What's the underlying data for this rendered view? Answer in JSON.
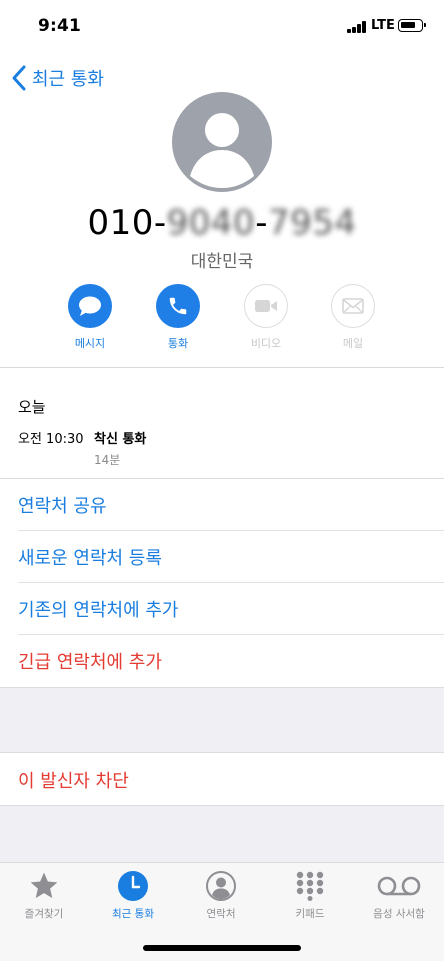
{
  "status_bar": {
    "time": "9:41",
    "network": "LTE"
  },
  "nav": {
    "back_label": "최근 통화"
  },
  "contact": {
    "number_prefix": "010-",
    "number_hidden_1": "9040",
    "number_sep": "-",
    "number_hidden_2": "7954",
    "country": "대한민국"
  },
  "actions": [
    {
      "label": "메시지",
      "icon": "message-icon",
      "enabled": true
    },
    {
      "label": "통화",
      "icon": "phone-icon",
      "enabled": true
    },
    {
      "label": "비디오",
      "icon": "video-icon",
      "enabled": false
    },
    {
      "label": "메일",
      "icon": "mail-icon",
      "enabled": false
    }
  ],
  "call_log": {
    "day": "오늘",
    "time": "오전 10:30",
    "type": "착신 통화",
    "duration": "14분"
  },
  "menu": [
    {
      "label": "연락처 공유"
    },
    {
      "label": "새로운 연락처 등록"
    },
    {
      "label": "기존의 연락처에 추가"
    },
    {
      "label": "긴급 연락처에 추가"
    }
  ],
  "block": {
    "label": "이 발신자 차단"
  },
  "tabs": [
    {
      "label": "즐겨찾기",
      "icon": "star-icon",
      "active": false
    },
    {
      "label": "최근 통화",
      "icon": "clock-icon",
      "active": true
    },
    {
      "label": "연락처",
      "icon": "contacts-icon",
      "active": false
    },
    {
      "label": "키패드",
      "icon": "keypad-icon",
      "active": false
    },
    {
      "label": "음성 사서함",
      "icon": "voicemail-icon",
      "active": false
    }
  ],
  "colors": {
    "accent": "#1a7ee0",
    "destructive": "#e43b32",
    "avatar": "#9ea2aa",
    "band": "#efeff4"
  }
}
